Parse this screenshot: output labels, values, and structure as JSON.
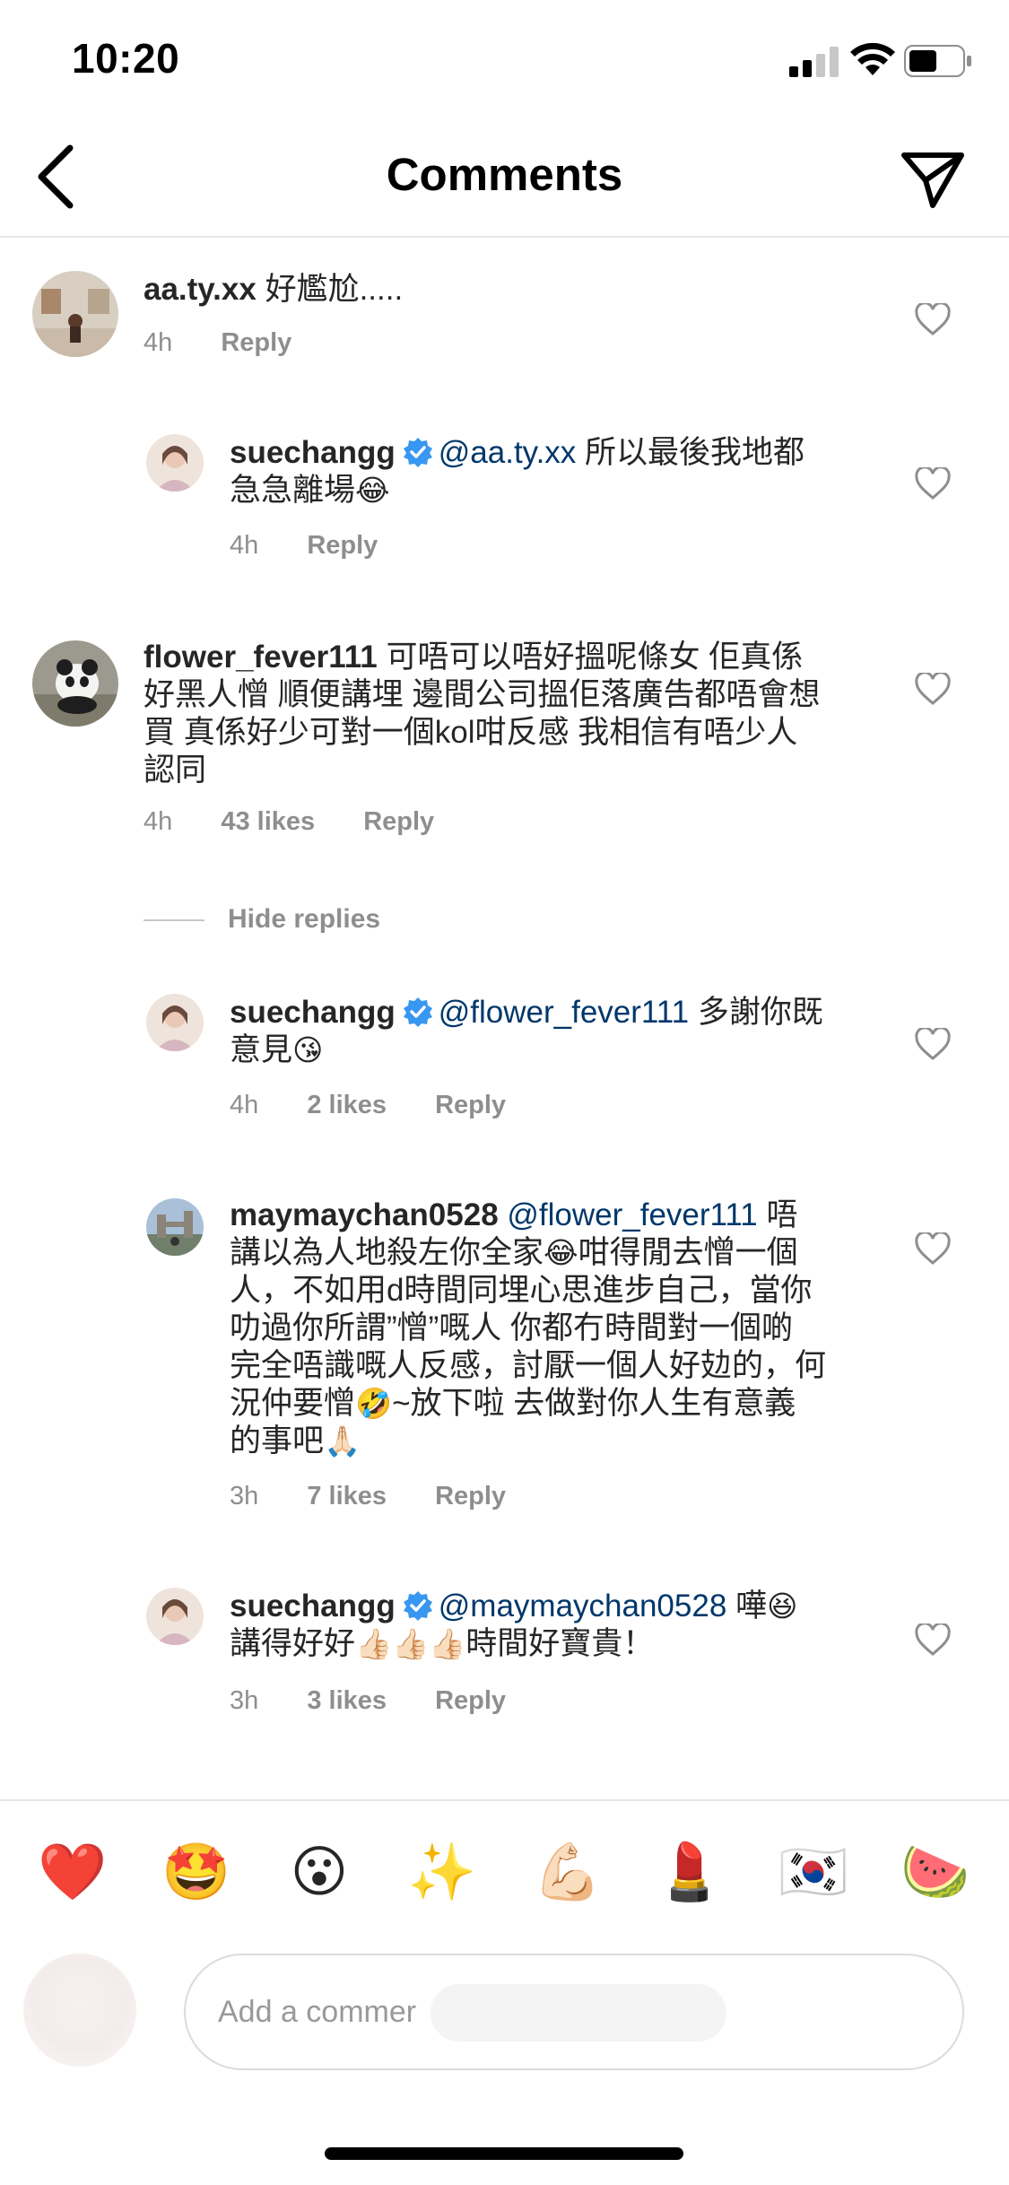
{
  "status_bar": {
    "time": "10:20"
  },
  "nav": {
    "title": "Comments"
  },
  "comments": [
    {
      "username": "aa.ty.xx",
      "text": "好尷尬.....",
      "time": "4h",
      "reply": "Reply"
    },
    {
      "username": "suechangg",
      "mention": "@aa.ty.xx",
      "text_line1": "所以最後我地都",
      "text_line2": "急急離場",
      "emoji": "😂",
      "time": "4h",
      "reply": "Reply"
    },
    {
      "username": "flower_fever111",
      "text_lines": [
        "可唔可以唔好搵呢條女 佢真係",
        "好黑人憎 順便講埋 邊間公司搵佢落廣告都唔會想",
        "買 真係好少可對一個kol咁反感 我相信有唔少人",
        "認同"
      ],
      "time": "4h",
      "likes": "43 likes",
      "reply": "Reply"
    },
    {
      "username": "suechangg",
      "mention": "@flower_fever111",
      "text_line1": "多謝你既",
      "text_line2": "意見",
      "emoji": "😘",
      "time": "4h",
      "likes": "2 likes",
      "reply": "Reply"
    },
    {
      "username": "maymaychan0528",
      "mention": "@flower_fever111",
      "text_line1": "唔",
      "text_lines": [
        "講以為人地殺左你全家",
        "咁得閒去憎一個",
        "人，不如用d時間同埋心思進步自己，當你",
        "叻過你所謂”憎”嘅人 你都冇時間對一個啲",
        "完全唔識嘅人反感，討厭一個人好攰的，何",
        "況仲要憎",
        "~放下啦 去做對你人生有意義",
        "的事吧"
      ],
      "emojis": [
        "😂",
        "🤣",
        "🙏🏻"
      ],
      "time": "3h",
      "likes": "7 likes",
      "reply": "Reply"
    },
    {
      "username": "suechangg",
      "mention": "@maymaychan0528",
      "text_line1": "嘩",
      "text_line2": "講得好好",
      "text_line2b": "時間好寶貴！",
      "emojis": [
        "😆",
        "👍🏻👍🏻👍🏻"
      ],
      "time": "3h",
      "likes": "3 likes",
      "reply": "Reply"
    }
  ],
  "hide_replies": "Hide replies",
  "emoji_bar": [
    "❤️",
    "🤩",
    "😮",
    "✨",
    "💪🏻",
    "💄",
    "🇰🇷",
    "🍉"
  ],
  "input": {
    "placeholder": "Add a commer"
  },
  "colors": {
    "text": "#262626",
    "meta": "#8e8e8e",
    "mention": "#00376b",
    "verified": "#3897f0"
  }
}
